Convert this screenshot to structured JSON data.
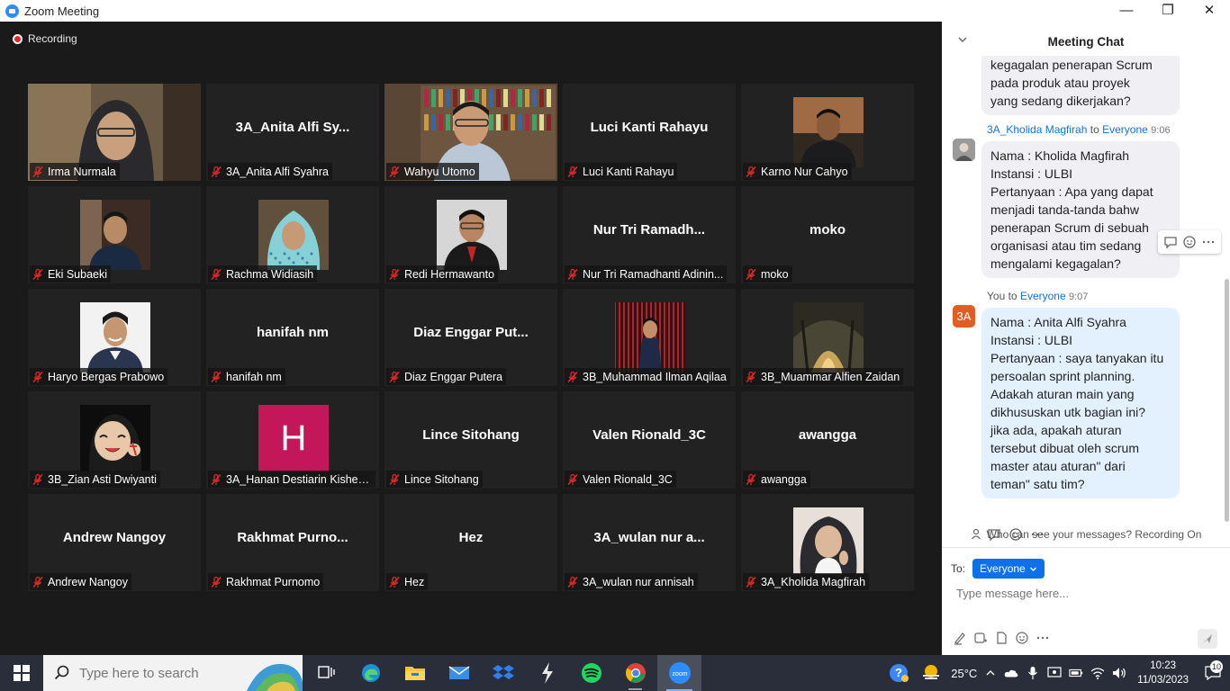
{
  "window": {
    "title": "Zoom Meeting",
    "minimize": "—",
    "maximize": "❐",
    "close": "✕"
  },
  "recording": "Recording",
  "tiles": [
    {
      "label": "Irma Nurmala",
      "display": "",
      "type": "photo"
    },
    {
      "label": "3A_Anita Alfi Syahra",
      "display": "3A_Anita Alfi Sy...",
      "type": "name"
    },
    {
      "label": "Wahyu Utomo",
      "display": "",
      "type": "photo",
      "active": true
    },
    {
      "label": "Luci Kanti Rahayu",
      "display": "Luci Kanti Rahayu",
      "type": "name"
    },
    {
      "label": "Karno Nur Cahyo",
      "display": "",
      "type": "avatar"
    },
    {
      "label": "Eki Subaeki",
      "display": "",
      "type": "avatar"
    },
    {
      "label": "Rachma Widiasih",
      "display": "",
      "type": "avatar"
    },
    {
      "label": "Redi Hermawanto",
      "display": "",
      "type": "avatar"
    },
    {
      "label": "Nur Tri Ramadhanti Adinin...",
      "display": "Nur Tri Ramadh...",
      "type": "name"
    },
    {
      "label": "moko",
      "display": "moko",
      "type": "name"
    },
    {
      "label": "Haryo Bergas Prabowo",
      "display": "",
      "type": "avatar"
    },
    {
      "label": "hanifah nm",
      "display": "hanifah nm",
      "type": "name"
    },
    {
      "label": "Diaz Enggar Putera",
      "display": "Diaz  Enggar  Put...",
      "type": "name"
    },
    {
      "label": "3B_Muhammad Ilman Aqilaa",
      "display": "",
      "type": "avatar"
    },
    {
      "label": "3B_Muammar Alfien Zaidan",
      "display": "",
      "type": "avatar"
    },
    {
      "label": "3B_Zian Asti Dwiyanti",
      "display": "",
      "type": "avatar"
    },
    {
      "label": "3A_Hanan Destiarin Kishen...",
      "display": "H",
      "type": "initial"
    },
    {
      "label": "Lince Sitohang",
      "display": "Lince Sitohang",
      "type": "name"
    },
    {
      "label": "Valen Rionald_3C",
      "display": "Valen Rionald_3C",
      "type": "name"
    },
    {
      "label": "awangga",
      "display": "awangga",
      "type": "name"
    },
    {
      "label": "Andrew Nangoy",
      "display": "Andrew Nangoy",
      "type": "name"
    },
    {
      "label": "Rakhmat Purnomo",
      "display": "Rakhmat  Purno...",
      "type": "name"
    },
    {
      "label": "Hez",
      "display": "Hez",
      "type": "name"
    },
    {
      "label": "3A_wulan nur annisah",
      "display": "3A_wulan nur a...",
      "type": "name"
    },
    {
      "label": "3A_Kholida Magfirah",
      "display": "",
      "type": "avatar"
    }
  ],
  "chat": {
    "title": "Meeting Chat",
    "messages": [
      {
        "text_lines": [
          "kegagalan penerapan Scrum",
          "pada produk atau proyek",
          "yang sedang dikerjakan?"
        ]
      },
      {
        "sender": "3A_Kholida Magfirah",
        "to_word": "to",
        "to": "Everyone",
        "time": "9:06",
        "text_lines": [
          "Nama : Kholida Magfirah",
          "Instansi : ULBI",
          "Pertanyaan : Apa yang dapat",
          "menjadi tanda-tanda bahw",
          "penerapan Scrum di sebuah",
          "organisasi atau tim sedang",
          "mengalami kegagalan?"
        ]
      },
      {
        "sender": "You",
        "to_word": "to",
        "to": "Everyone",
        "time": "9:07",
        "avatar": "3A",
        "text_lines": [
          "Nama : Anita Alfi Syahra",
          "Instansi : ULBI",
          "Pertanyaan : saya tanyakan itu",
          "persoalan sprint planning.",
          "Adakah aturan main yang",
          "dikhususkan utk bagian ini?",
          "jika ada, apakah aturan",
          "tersebut dibuat oleh scrum",
          "master atau aturan\" dari",
          "teman\" satu tim?"
        ]
      }
    ],
    "privacy_note": "Who can see your messages? Recording On",
    "to_label": "To:",
    "recipient": "Everyone",
    "input_placeholder": "Type message here..."
  },
  "taskbar": {
    "search_placeholder": "Type here to search",
    "temperature": "25°C",
    "time": "10:23",
    "date": "11/03/2023",
    "notifications": "10"
  }
}
